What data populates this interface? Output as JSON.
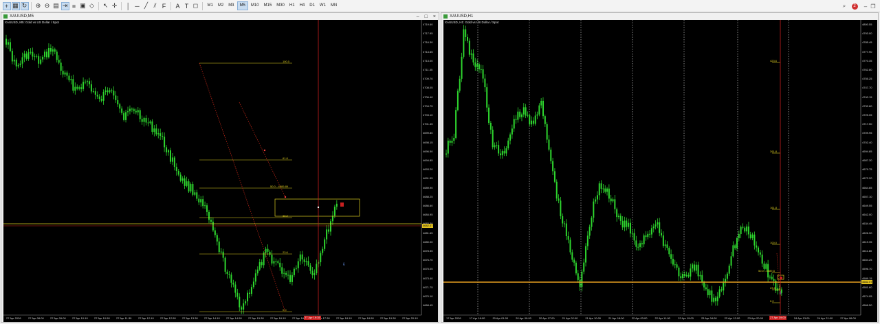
{
  "colors": {
    "candle": "#2ed62e",
    "fib_line": "#e0d020",
    "trend_line": "#d42a1a",
    "vertical_marker": "#c81e1e",
    "horizontal_price": "#e8a020",
    "background": "#000000"
  },
  "toolbar": {
    "left_icons": [
      "crosshair-icon",
      "grid-icon",
      "auto-scroll-icon",
      "zoom-in-icon",
      "zoom-out-icon",
      "tile-windows-icon",
      "chart-shift-icon",
      "indicator-list-icon",
      "templates-icon",
      "objects-icon",
      "cursor-icon",
      "crosshair-tool-icon",
      "vertical-line-icon",
      "horizontal-line-icon",
      "trendline-icon",
      "channel-icon",
      "fibonacci-icon",
      "text-icon",
      "label-icon",
      "shapes-icon"
    ],
    "timeframes": [
      "M1",
      "M2",
      "M3",
      "M5",
      "M10",
      "M15",
      "M30",
      "H1",
      "H4",
      "D1",
      "W1",
      "MN"
    ],
    "active_timeframe": "M5",
    "notifications_count": "2"
  },
  "left": {
    "title": "XAUUSD,M5",
    "symbol": "XAUUSD, M5:  Gold vs US Dollar / Spot",
    "prices": [
      "4719.60",
      "4717.95",
      "4716.30",
      "4714.65",
      "4713.00",
      "4711.35",
      "4709.70",
      "4708.05",
      "4706.40",
      "4704.75",
      "4703.10",
      "4701.45",
      "4699.80",
      "4698.15",
      "4696.50",
      "4694.85",
      "4693.20",
      "4691.55",
      "4689.90",
      "4688.25",
      "4686.60",
      "4684.95",
      "4683.30",
      "4681.65",
      "4680.00",
      "4678.35",
      "4676.70",
      "4675.05",
      "4673.40",
      "4671.75",
      "4670.10",
      "4668.45"
    ],
    "current_price": "4682.07",
    "time_labels": [
      "27 Apr 2026",
      "27 Apr 08:00",
      "27 Apr 09:00",
      "27 Apr 10:10",
      "27 Apr 10:50",
      "27 Apr 11:30",
      "27 Apr 12:10",
      "27 Apr 12:50",
      "27 Apr 13:30",
      "27 Apr 14:10",
      "27 Apr 14:50",
      "27 Apr 15:30",
      "27 Apr 16:10",
      "27 Apr 16:50",
      "27 Apr 17:30",
      "27 Apr 18:10",
      "27 Apr 18:50",
      "27 Apr 19:30",
      "27 Apr 20:10"
    ],
    "time_marker": "27 Apr 19:35",
    "fib": [
      {
        "label": "100.0"
      },
      {
        "label": "61.8"
      },
      {
        "label": "50.0 --4689.89"
      },
      {
        "label": "38.2"
      },
      {
        "label": "23.6"
      },
      {
        "label": "0.0"
      }
    ]
  },
  "right": {
    "title": "XAUUSD,H1",
    "symbol": "XAUUSD, H1:  Gold vs US Dollar / Spot",
    "prices": [
      "4800.55",
      "4793.00",
      "4785.45",
      "4777.90",
      "4770.35",
      "4762.80",
      "4755.25",
      "4747.70",
      "4740.15",
      "4732.60",
      "4725.05",
      "4717.50",
      "4709.95",
      "4702.40",
      "4694.85",
      "4687.30",
      "4679.75",
      "4672.20",
      "4664.65",
      "4657.10",
      "4649.55",
      "4642.00",
      "4634.45",
      "4626.90",
      "4619.35",
      "4611.80",
      "4604.25",
      "4596.70",
      "4589.15",
      "4581.60",
      "4574.05",
      "4566.50"
    ],
    "current_price": "4682.07",
    "time_labels": [
      "17 Apr 2026",
      "17 Apr 16:00",
      "20 Apr 01:00",
      "20 Apr 09:00",
      "20 Apr 17:00",
      "21 Apr 02:00",
      "21 Apr 10:00",
      "21 Apr 18:00",
      "22 Apr 03:00",
      "22 Apr 11:00",
      "22 Apr 19:00",
      "23 Apr 04:00",
      "23 Apr 12:00",
      "23 Apr 20:00",
      "24 Apr 05:00",
      "24 Apr 13:00",
      "24 Apr 21:00",
      "27 Apr 06:00"
    ],
    "time_marker": "27 Apr 19:00",
    "fib": [
      {
        "label": "423.6"
      },
      {
        "label": "261.8"
      },
      {
        "label": "161.8"
      },
      {
        "label": "100.0"
      },
      {
        "label": "50.0 --4689.8"
      },
      {
        "label": "23.6"
      },
      {
        "label": "0.0"
      }
    ]
  }
}
